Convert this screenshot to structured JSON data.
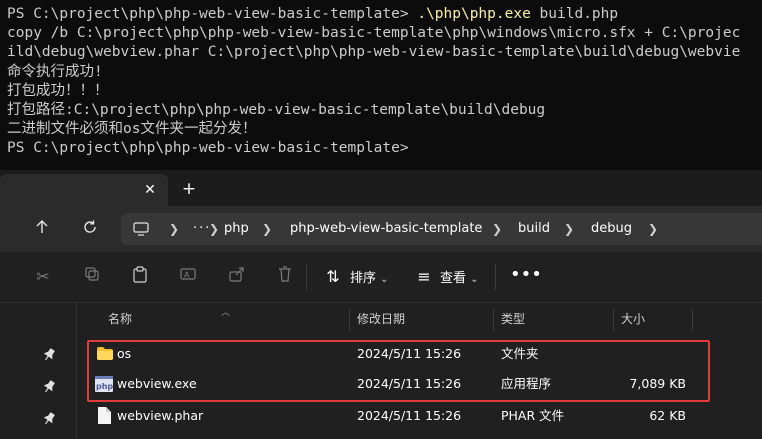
{
  "terminal": {
    "lines": [
      {
        "prompt": "PS C:\\project\\php\\php-web-view-basic-template> ",
        "cmd": ".\\php\\php.exe",
        "args": " build.php"
      },
      {
        "text": "copy /b C:\\project\\php\\php-web-view-basic-template\\php\\windows\\micro.sfx + C:\\projec"
      },
      {
        "text": "ild\\debug\\webview.phar C:\\project\\php\\php-web-view-basic-template\\build\\debug\\webvie"
      },
      {
        "text": "命令执行成功!"
      },
      {
        "text": "打包成功！！！"
      },
      {
        "text": "打包路径:C:\\project\\php\\php-web-view-basic-template\\build\\debug"
      },
      {
        "text": "二进制文件必须和os文件夹一起分发！"
      },
      {
        "text": "PS C:\\project\\php\\php-web-view-basic-template>"
      }
    ]
  },
  "explorer": {
    "tab": {
      "close": "✕"
    },
    "tab_add": "+",
    "breadcrumb": [
      "php",
      "php-web-view-basic-template",
      "build",
      "debug"
    ],
    "toolbar": {
      "sort_label": "排序",
      "view_label": "查看",
      "more": "•••"
    },
    "columns": {
      "name": "名称",
      "modified": "修改日期",
      "type": "类型",
      "size": "大小"
    },
    "files": [
      {
        "name": "os",
        "modified": "2024/5/11 15:26",
        "type": "文件夹",
        "size": "",
        "icon": "folder-icon"
      },
      {
        "name": "webview.exe",
        "modified": "2024/5/11 15:26",
        "type": "应用程序",
        "size": "7,089 KB",
        "icon": "php-exe-icon"
      },
      {
        "name": "webview.phar",
        "modified": "2024/5/11 15:26",
        "type": "PHAR 文件",
        "size": "62 KB",
        "icon": "file-icon"
      }
    ]
  },
  "colors": {
    "highlight_box": "#e23b3b",
    "terminal_bg": "#0c0c0c",
    "explorer_bg": "#202020"
  }
}
